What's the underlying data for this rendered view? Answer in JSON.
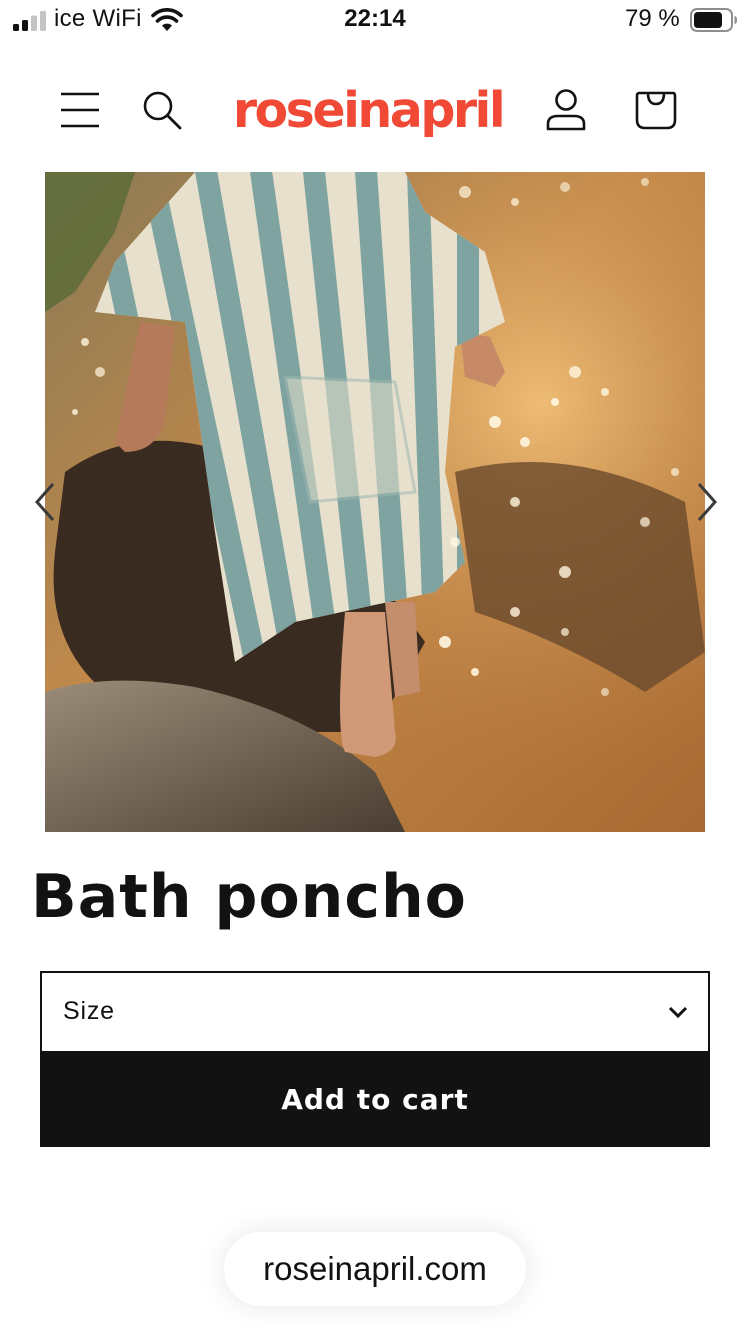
{
  "status_bar": {
    "carrier": "ice WiFi",
    "time": "22:14",
    "battery": "79 %",
    "signal_bars_active": 2,
    "signal_bars_total": 4,
    "battery_level": 0.79
  },
  "header": {
    "logo_text": "roseinapril",
    "logo_color": "#f04a36",
    "icons": [
      "hamburger-menu-icon",
      "search-icon",
      "account-icon",
      "cart-icon"
    ]
  },
  "gallery": {
    "prev_icon": "chevron-left-icon",
    "next_icon": "chevron-right-icon"
  },
  "product": {
    "title": "Bath poncho",
    "size_label": "Size",
    "add_to_cart": "Add to cart",
    "stripe_color": "#7fa3a0"
  },
  "browser": {
    "url": "roseinapril.com"
  }
}
